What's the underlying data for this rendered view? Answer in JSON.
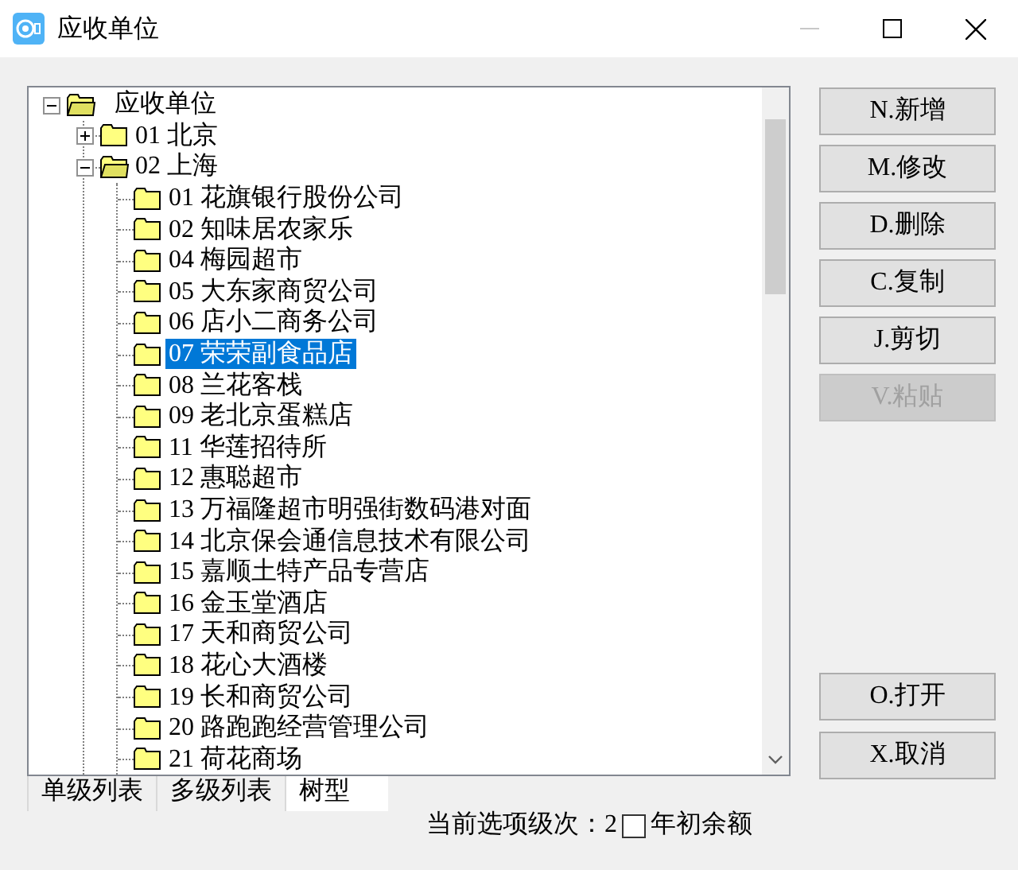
{
  "window": {
    "title": "应收单位"
  },
  "tree": {
    "label": "应收单位",
    "expanded": true,
    "selected": false,
    "children": [
      {
        "code": "01",
        "name": "北京",
        "expanded": false,
        "selected": false
      },
      {
        "code": "02",
        "name": "上海",
        "expanded": true,
        "selected": false,
        "children": [
          {
            "code": "01",
            "name": "花旗银行股份公司",
            "selected": false
          },
          {
            "code": "02",
            "name": "知味居农家乐",
            "selected": false
          },
          {
            "code": "04",
            "name": "梅园超市",
            "selected": false
          },
          {
            "code": "05",
            "name": "大东家商贸公司",
            "selected": false
          },
          {
            "code": "06",
            "name": "店小二商务公司",
            "selected": false
          },
          {
            "code": "07",
            "name": "荣荣副食品店",
            "selected": true
          },
          {
            "code": "08",
            "name": "兰花客栈",
            "selected": false
          },
          {
            "code": "09",
            "name": "老北京蛋糕店",
            "selected": false
          },
          {
            "code": "11",
            "name": "华莲招待所",
            "selected": false
          },
          {
            "code": "12",
            "name": "惠聪超市",
            "selected": false
          },
          {
            "code": "13",
            "name": "万福隆超市明强街数码港对面",
            "selected": false
          },
          {
            "code": "14",
            "name": "北京保会通信息技术有限公司",
            "selected": false
          },
          {
            "code": "15",
            "name": "嘉顺土特产品专营店",
            "selected": false
          },
          {
            "code": "16",
            "name": "金玉堂酒店",
            "selected": false
          },
          {
            "code": "17",
            "name": "天和商贸公司",
            "selected": false
          },
          {
            "code": "18",
            "name": "花心大酒楼",
            "selected": false
          },
          {
            "code": "19",
            "name": "长和商贸公司",
            "selected": false
          },
          {
            "code": "20",
            "name": "路跑跑经营管理公司",
            "selected": false
          },
          {
            "code": "21",
            "name": "荷花商场",
            "selected": false
          }
        ]
      }
    ]
  },
  "view_tabs": [
    {
      "label": "单级列表",
      "selected": false
    },
    {
      "label": "多级列表",
      "selected": false
    },
    {
      "label": "树型",
      "selected": true
    }
  ],
  "status": {
    "text": "当前选项级次：2",
    "checkbox": {
      "label": "年初余额",
      "checked": false
    }
  },
  "top_buttons": [
    {
      "label": "N.新增",
      "disabled": false
    },
    {
      "label": "M.修改",
      "disabled": false
    },
    {
      "label": "D.删除",
      "disabled": false
    },
    {
      "label": "C.复制",
      "disabled": false
    },
    {
      "label": "J.剪切",
      "disabled": false
    },
    {
      "label": "V.粘贴",
      "disabled": true
    }
  ],
  "bottom_buttons": [
    {
      "label": "O.打开",
      "disabled": false
    },
    {
      "label": "X.取消",
      "disabled": false
    }
  ]
}
